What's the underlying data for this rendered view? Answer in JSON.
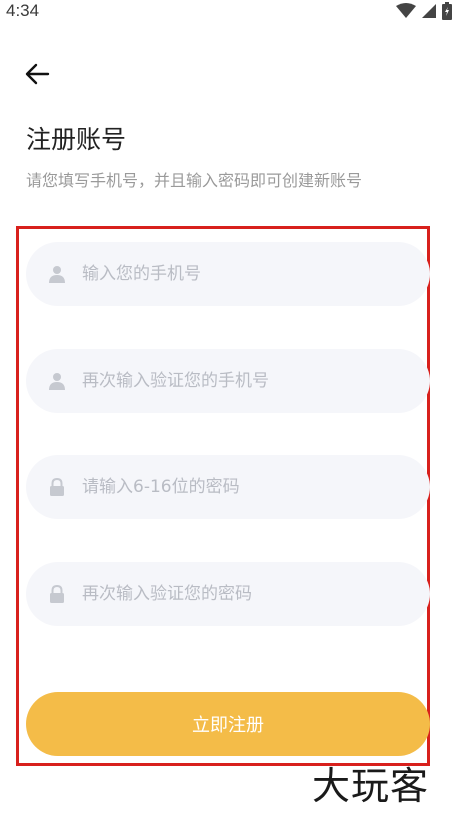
{
  "status_bar": {
    "time": "4:34",
    "icons": [
      "wifi-icon",
      "signal-icon",
      "battery-icon"
    ]
  },
  "header": {
    "back_icon": "arrow-left-icon",
    "title": "注册账号",
    "subtitle": "请您填写手机号，并且输入密码即可创建新账号"
  },
  "form": {
    "phone": {
      "placeholder": "输入您的手机号",
      "icon": "user-icon"
    },
    "phone_confirm": {
      "placeholder": "再次输入验证您的手机号",
      "icon": "user-icon"
    },
    "password": {
      "placeholder": "请输入6-16位的密码",
      "icon": "lock-icon"
    },
    "password_confirm": {
      "placeholder": "再次输入验证您的密码",
      "icon": "lock-icon"
    },
    "submit_label": "立即注册"
  },
  "watermark": "大玩客",
  "colors": {
    "accent": "#f4bc48",
    "field_bg": "#f5f6fa",
    "highlight_border": "#d8201c",
    "placeholder": "#b9bcc4"
  }
}
